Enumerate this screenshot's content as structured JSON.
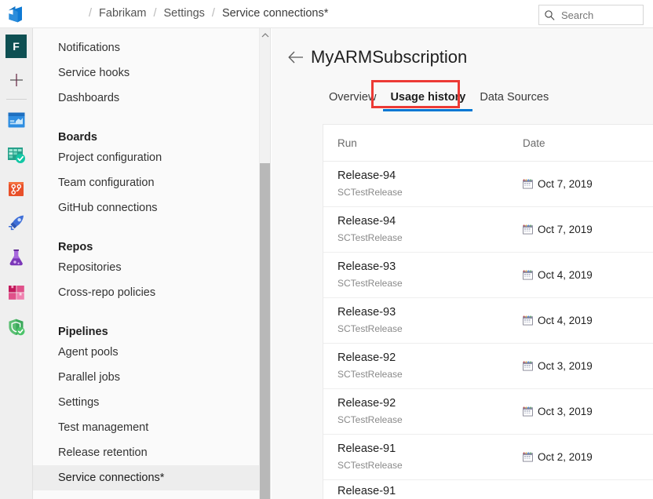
{
  "topbar": {
    "logo_icon": "azure-devops-logo",
    "breadcrumb": [
      {
        "label": "Fabrikam"
      },
      {
        "label": "Settings"
      },
      {
        "label": "Service connections*"
      }
    ],
    "separator": "/",
    "search": {
      "icon": "search-icon",
      "placeholder": "Search",
      "value": ""
    }
  },
  "rail": {
    "avatar_label": "F",
    "add_icon": "plus-icon",
    "icons": [
      {
        "name": "overview-icon",
        "title": "Overview"
      },
      {
        "name": "boards-icon",
        "title": "Boards"
      },
      {
        "name": "repos-icon",
        "title": "Repos"
      },
      {
        "name": "pipelines-icon",
        "title": "Pipelines"
      },
      {
        "name": "test-plans-icon",
        "title": "Test Plans"
      },
      {
        "name": "artifacts-icon",
        "title": "Artifacts"
      },
      {
        "name": "security-icon",
        "title": "Security"
      }
    ]
  },
  "sidebar": {
    "items": [
      {
        "label": "Notifications",
        "type": "item",
        "selected": false
      },
      {
        "label": "Service hooks",
        "type": "item",
        "selected": false
      },
      {
        "label": "Dashboards",
        "type": "item",
        "selected": false
      },
      {
        "label": "Boards",
        "type": "group"
      },
      {
        "label": "Project configuration",
        "type": "item",
        "selected": false
      },
      {
        "label": "Team configuration",
        "type": "item",
        "selected": false
      },
      {
        "label": "GitHub connections",
        "type": "item",
        "selected": false
      },
      {
        "label": "Repos",
        "type": "group"
      },
      {
        "label": "Repositories",
        "type": "item",
        "selected": false
      },
      {
        "label": "Cross-repo policies",
        "type": "item",
        "selected": false
      },
      {
        "label": "Pipelines",
        "type": "group"
      },
      {
        "label": "Agent pools",
        "type": "item",
        "selected": false
      },
      {
        "label": "Parallel jobs",
        "type": "item",
        "selected": false
      },
      {
        "label": "Settings",
        "type": "item",
        "selected": false
      },
      {
        "label": "Test management",
        "type": "item",
        "selected": false
      },
      {
        "label": "Release retention",
        "type": "item",
        "selected": false
      },
      {
        "label": "Service connections*",
        "type": "item",
        "selected": true
      }
    ],
    "scrollbar": {
      "up_arrow_icon": "chevron-up-icon"
    }
  },
  "main": {
    "back_icon": "back-arrow-icon",
    "title": "MyARMSubscription",
    "tabs": [
      {
        "label": "Overview",
        "active": false
      },
      {
        "label": "Usage history",
        "active": true
      },
      {
        "label": "Data Sources",
        "active": false
      }
    ],
    "annotation": {
      "type": "red-highlight-box",
      "color": "#ec3a35",
      "target": "Usage history"
    },
    "table": {
      "columns": [
        {
          "key": "run",
          "label": "Run"
        },
        {
          "key": "date",
          "label": "Date"
        }
      ],
      "date_icon": "calendar-icon",
      "rows": [
        {
          "run": "Release-94",
          "sub": "SCTestRelease",
          "date": "Oct 7, 2019",
          "partial": false
        },
        {
          "run": "Release-94",
          "sub": "SCTestRelease",
          "date": "Oct 7, 2019",
          "partial": false
        },
        {
          "run": "Release-93",
          "sub": "SCTestRelease",
          "date": "Oct 4, 2019",
          "partial": false
        },
        {
          "run": "Release-93",
          "sub": "SCTestRelease",
          "date": "Oct 4, 2019",
          "partial": false
        },
        {
          "run": "Release-92",
          "sub": "SCTestRelease",
          "date": "Oct 3, 2019",
          "partial": false
        },
        {
          "run": "Release-92",
          "sub": "SCTestRelease",
          "date": "Oct 3, 2019",
          "partial": false
        },
        {
          "run": "Release-91",
          "sub": "SCTestRelease",
          "date": "Oct 2, 2019",
          "partial": false
        },
        {
          "run": "Release-91",
          "sub": "",
          "date": "",
          "partial": true
        }
      ]
    }
  },
  "colors": {
    "accent": "#0078d4",
    "annotation": "#ec3a35",
    "avatar_bg": "#0e4f52",
    "page_bg": "#f8f8f8",
    "sidebar_bg": "#fafafa"
  }
}
